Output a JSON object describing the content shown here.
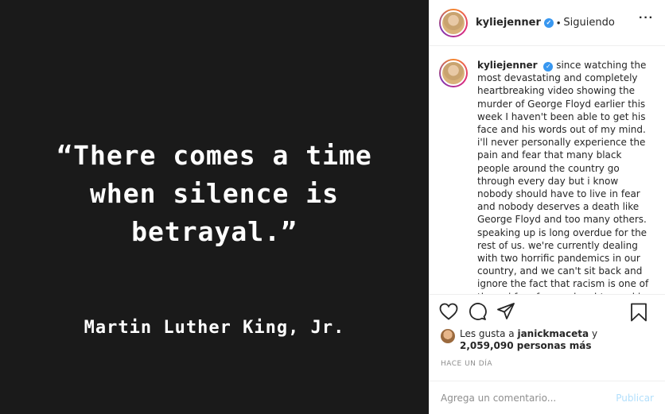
{
  "media": {
    "quote": "“There comes a time\nwhen silence is\nbetrayal.”",
    "attribution": "Martin Luther King, Jr."
  },
  "header": {
    "username": "kyliejenner",
    "separator": "•",
    "follow_status": "Siguiendo",
    "more_label": "···"
  },
  "caption": {
    "username": "kyliejenner",
    "text": "since watching the most devastating and completely heartbreaking video showing the murder of George Floyd earlier this week I haven't been able to get his face and his words out of my mind. i'll never personally experience the pain and fear that many black people around the country go through every day but i know nobody should have to live in fear and nobody deserves a death like George Floyd and too many others. speaking up is long overdue for the rest of us. we're currently dealing with two horrific pandemics in our country, and we can't sit back and ignore the fact that racism is one of them. i fear for my daughter and i hope for a better future for her. my"
  },
  "likes": {
    "prefix": "Les gusta a",
    "user": "janickmaceta",
    "conjunction": "y",
    "count": "2,059,090 personas más"
  },
  "timestamp": "HACE UN DÍA",
  "comment": {
    "placeholder": "Agrega un comentario...",
    "post_label": "Publicar"
  },
  "colors": {
    "media_bg": "#1a1a1a",
    "verified": "#3897f0",
    "post_disabled": "#b2dffc",
    "muted": "#8e8e8e"
  },
  "icons": [
    "heart-icon",
    "comment-icon",
    "share-icon",
    "bookmark-icon",
    "verified-icon",
    "more-icon"
  ]
}
